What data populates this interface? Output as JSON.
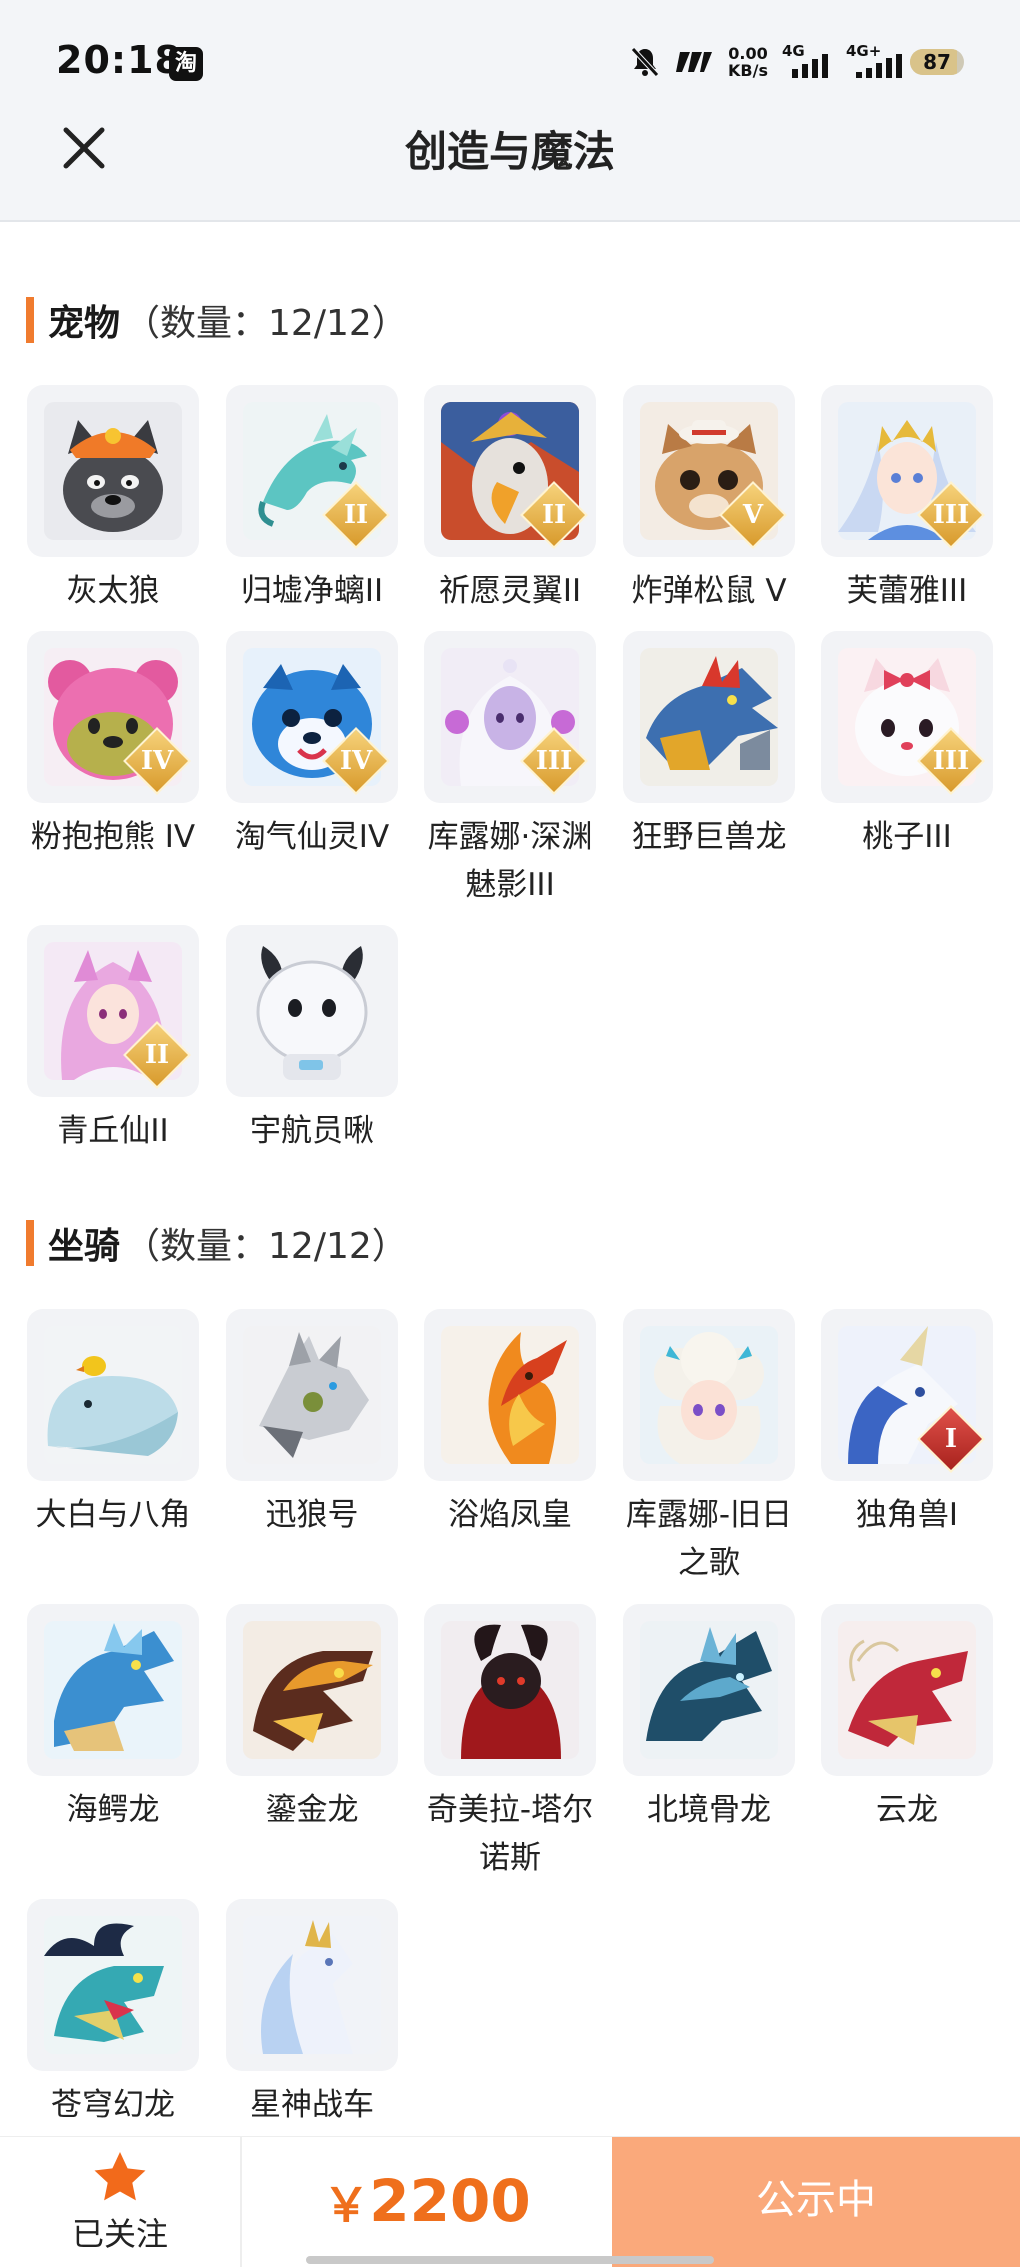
{
  "status_bar": {
    "time": "20:18",
    "app_badge": "淘",
    "net_speed_value": "0.00",
    "net_speed_unit": "KB/s",
    "signal1": "4G",
    "signal2": "4G+",
    "battery": "87",
    "battery_level": 0.87
  },
  "header": {
    "title": "创造与魔法"
  },
  "pets": {
    "title": "宠物",
    "count": "（数量：12/12）",
    "items": [
      {
        "name": "灰太狼",
        "icon": "grey-wolf-portrait",
        "tier": ""
      },
      {
        "name": "归墟净螭II",
        "icon": "teal-dragon-portrait",
        "tier": "II"
      },
      {
        "name": "祈愿灵翼II",
        "icon": "phoenix-bird-portrait",
        "tier": "II"
      },
      {
        "name": "炸弹松鼠 V",
        "icon": "squirrel-portrait",
        "tier": "V"
      },
      {
        "name": "芙蕾雅III",
        "icon": "winged-girl-portrait",
        "tier": "III"
      },
      {
        "name": "粉抱抱熊 IV",
        "icon": "pink-bear-portrait",
        "tier": "IV"
      },
      {
        "name": "淘气仙灵IV",
        "icon": "blue-sprite-portrait",
        "tier": "IV"
      },
      {
        "name": "库露娜·深渊魅影III",
        "icon": "white-hair-girl-portrait",
        "tier": "III"
      },
      {
        "name": "狂野巨兽龙",
        "icon": "beast-dragon-portrait",
        "tier": ""
      },
      {
        "name": "桃子III",
        "icon": "white-cat-portrait",
        "tier": "III"
      },
      {
        "name": "青丘仙II",
        "icon": "fox-girl-portrait",
        "tier": "II"
      },
      {
        "name": "宇航员啾",
        "icon": "astronaut-portrait",
        "tier": ""
      }
    ]
  },
  "mounts": {
    "title": "坐骑",
    "count": "（数量：12/12）",
    "items": [
      {
        "name": "大白与八角",
        "icon": "whale-portrait",
        "tier": ""
      },
      {
        "name": "迅狼号",
        "icon": "mech-wolf-portrait",
        "tier": ""
      },
      {
        "name": "浴焰凤皇",
        "icon": "fire-phoenix-portrait",
        "tier": ""
      },
      {
        "name": "库露娜-旧日之歌",
        "icon": "sheep-girl-portrait",
        "tier": ""
      },
      {
        "name": "独角兽I",
        "icon": "unicorn-portrait",
        "tier": "I"
      },
      {
        "name": "海鳄龙",
        "icon": "sea-dragon-portrait",
        "tier": ""
      },
      {
        "name": "鎏金龙",
        "icon": "gold-dragon-portrait",
        "tier": ""
      },
      {
        "name": "奇美拉-塔尔诺斯",
        "icon": "chimera-portrait",
        "tier": ""
      },
      {
        "name": "北境骨龙",
        "icon": "bone-dragon-portrait",
        "tier": ""
      },
      {
        "name": "云龙",
        "icon": "cloud-dragon-portrait",
        "tier": ""
      },
      {
        "name": "苍穹幻龙",
        "icon": "sky-dragon-portrait",
        "tier": ""
      },
      {
        "name": "星神战车",
        "icon": "star-horse-portrait",
        "tier": ""
      }
    ]
  },
  "footer": {
    "follow_label": "已关注",
    "currency": "￥",
    "price": "2200",
    "status_button": "公示中"
  },
  "colors": {
    "accent": "#f07b2e",
    "price": "#ef6f1c",
    "status_button": "#faa97b",
    "star": "#f26a1b"
  }
}
